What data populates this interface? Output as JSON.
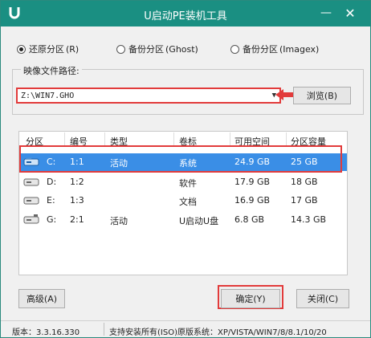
{
  "window": {
    "title": "U启动PE装机工具"
  },
  "mode_options": [
    {
      "label": "还原分区",
      "key": "(R)",
      "selected": true
    },
    {
      "label": "备份分区",
      "key": "(Ghost)",
      "selected": false
    },
    {
      "label": "备份分区",
      "key": "(Imagex)",
      "selected": false
    }
  ],
  "image_path": {
    "label": "映像文件路径:",
    "value": "Z:\\WIN7.GHO",
    "browse_label": "浏览(B)"
  },
  "table": {
    "columns": [
      "分区",
      "编号",
      "类型",
      "卷标",
      "可用空间",
      "分区容量"
    ],
    "rows": [
      {
        "drive": "C:",
        "num": "1:1",
        "type": "活动",
        "label": "系统",
        "free": "24.9 GB",
        "size": "25 GB",
        "selected": true
      },
      {
        "drive": "D:",
        "num": "1:2",
        "type": "",
        "label": "软件",
        "free": "17.9 GB",
        "size": "18 GB",
        "selected": false
      },
      {
        "drive": "E:",
        "num": "1:3",
        "type": "",
        "label": "文档",
        "free": "16.9 GB",
        "size": "17 GB",
        "selected": false
      },
      {
        "drive": "G:",
        "num": "2:1",
        "type": "活动",
        "label": "U启动U盘",
        "free": "6.8 GB",
        "size": "14.3 GB",
        "selected": false
      }
    ]
  },
  "buttons": {
    "advanced": "高级(A)",
    "confirm": "确定(Y)",
    "close": "关闭(C)"
  },
  "status": {
    "version": "版本：3.3.16.330",
    "support": "支持安装所有(ISO)原版系统：XP/VISTA/WIN7/8/8.1/10/20"
  },
  "colors": {
    "titlebar": "#1a8f82",
    "selection": "#3a8ee6",
    "highlight": "#e23b3b"
  }
}
